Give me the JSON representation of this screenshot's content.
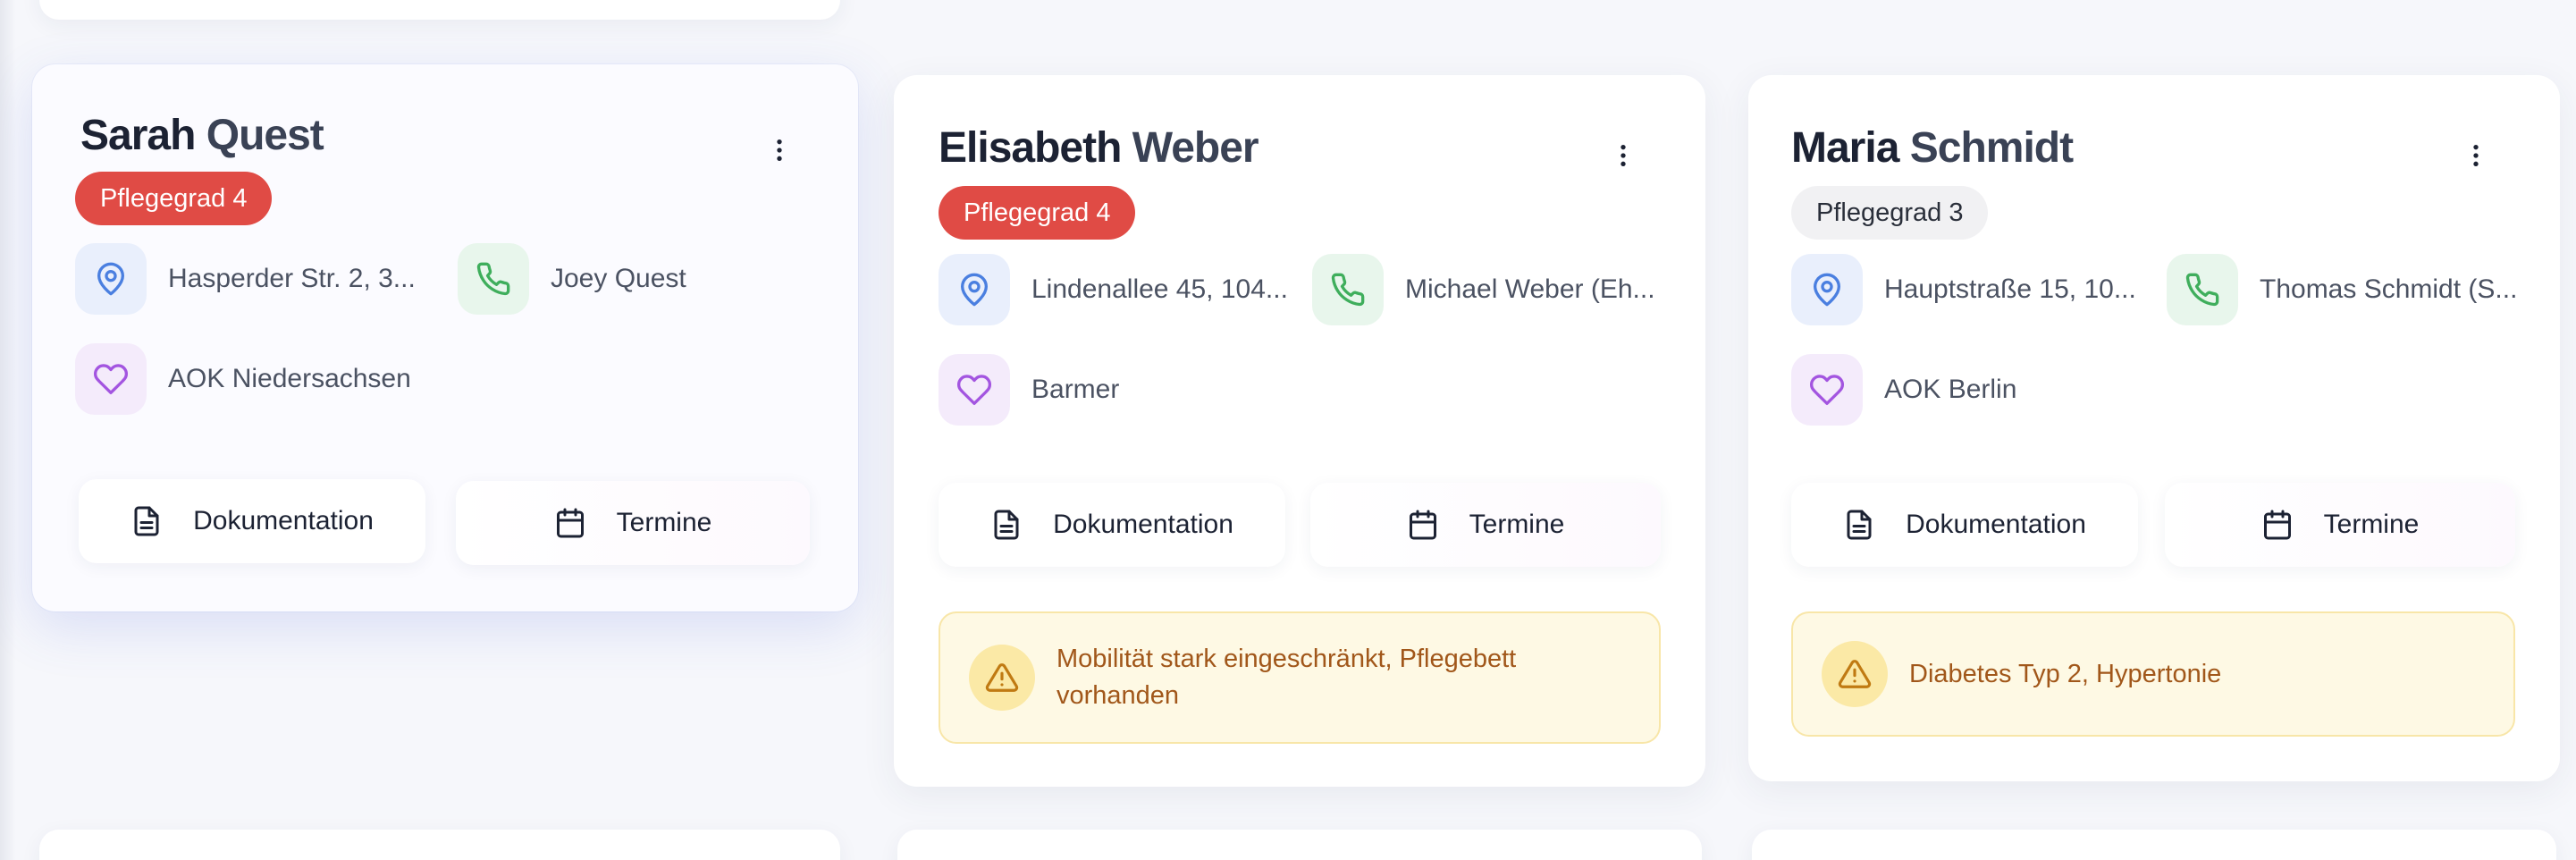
{
  "patients": [
    {
      "first_name": "Sarah",
      "last_name": "Quest",
      "care_level": "Pflegegrad 4",
      "address": "Hasperder Str. 2, 3...",
      "contact": "Joey Quest",
      "insurance": "AOK Niedersachsen",
      "doc_label": "Dokumentation",
      "appt_label": "Termine"
    },
    {
      "first_name": "Elisabeth",
      "last_name": "Weber",
      "care_level": "Pflegegrad 4",
      "address": "Lindenallee 45, 104...",
      "contact": "Michael Weber (Eh...",
      "insurance": "Barmer",
      "doc_label": "Dokumentation",
      "appt_label": "Termine",
      "alert": "Mobilität stark eingeschränkt, Pflegebett vorhanden"
    },
    {
      "first_name": "Maria",
      "last_name": "Schmidt",
      "care_level": "Pflegegrad 3",
      "address": "Hauptstraße 15, 10...",
      "contact": "Thomas Schmidt (S...",
      "insurance": "AOK Berlin",
      "doc_label": "Dokumentation",
      "appt_label": "Termine",
      "alert": "Diabetes Typ 2, Hypertonie"
    }
  ],
  "colors": {
    "badge_high": "#e04b45",
    "badge_normal": "#f1f1f3",
    "location_icon": "#4a7fe0",
    "phone_icon": "#3fae5c",
    "heart_icon": "#a355e0",
    "alert_text": "#a1571a",
    "alert_bg": "#fef9e4"
  },
  "icons": [
    "more-vertical-icon",
    "map-pin-icon",
    "phone-icon",
    "heart-icon",
    "file-text-icon",
    "calendar-icon",
    "alert-triangle-icon"
  ]
}
